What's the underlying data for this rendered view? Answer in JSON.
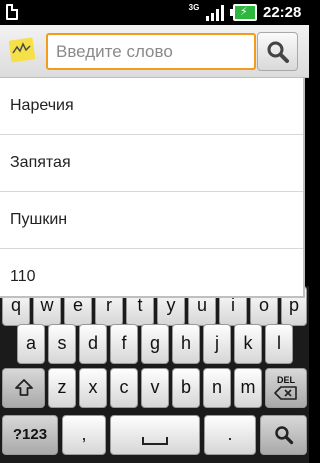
{
  "status_bar": {
    "network_type": "3G",
    "time": "22:28"
  },
  "search": {
    "placeholder": "Введите слово"
  },
  "suggestions": [
    {
      "label": "Наречия"
    },
    {
      "label": "Запятая"
    },
    {
      "label": "Пушкин"
    },
    {
      "label": "110"
    }
  ],
  "keyboard": {
    "row1": [
      "q",
      "w",
      "e",
      "r",
      "t",
      "y",
      "u",
      "i",
      "o",
      "p"
    ],
    "row2": [
      "a",
      "s",
      "d",
      "f",
      "g",
      "h",
      "j",
      "k",
      "l"
    ],
    "row3": [
      "z",
      "x",
      "c",
      "v",
      "b",
      "n",
      "m"
    ],
    "symbols_label": "?123",
    "comma_label": ",",
    "period_label": ".",
    "delete_label": "DEL"
  },
  "colors": {
    "accent": "#f29b1d",
    "battery": "#2fb63e"
  }
}
